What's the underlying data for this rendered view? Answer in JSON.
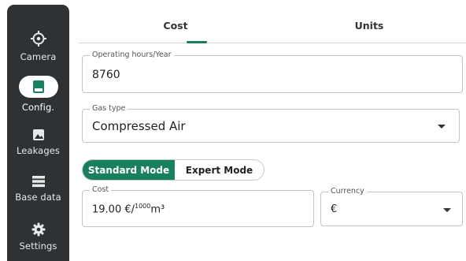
{
  "sidebar": {
    "items": [
      {
        "label": "Camera",
        "icon": "camera-icon"
      },
      {
        "label": "Config.",
        "icon": "config-icon",
        "active": true
      },
      {
        "label": "Leakages",
        "icon": "image-icon"
      },
      {
        "label": "Base data",
        "icon": "list-icon"
      },
      {
        "label": "Settings",
        "icon": "gear-icon"
      }
    ]
  },
  "tabs": [
    {
      "label": "Cost",
      "active": true
    },
    {
      "label": "Units",
      "active": false
    }
  ],
  "form": {
    "operating_hours": {
      "label": "Operating hours/Year",
      "value": "8760"
    },
    "gas_type": {
      "label": "Gas type",
      "value": "Compressed Air"
    },
    "mode": {
      "options": [
        "Standard Mode",
        "Expert Mode"
      ],
      "selected": "Standard Mode"
    },
    "cost": {
      "label": "Cost",
      "value": "19.00 €/",
      "unit_sup": "1000",
      "unit": "m³"
    },
    "currency": {
      "label": "Currency",
      "value": "€"
    }
  },
  "colors": {
    "accent": "#19805f",
    "sidebar": "#2f3234"
  }
}
